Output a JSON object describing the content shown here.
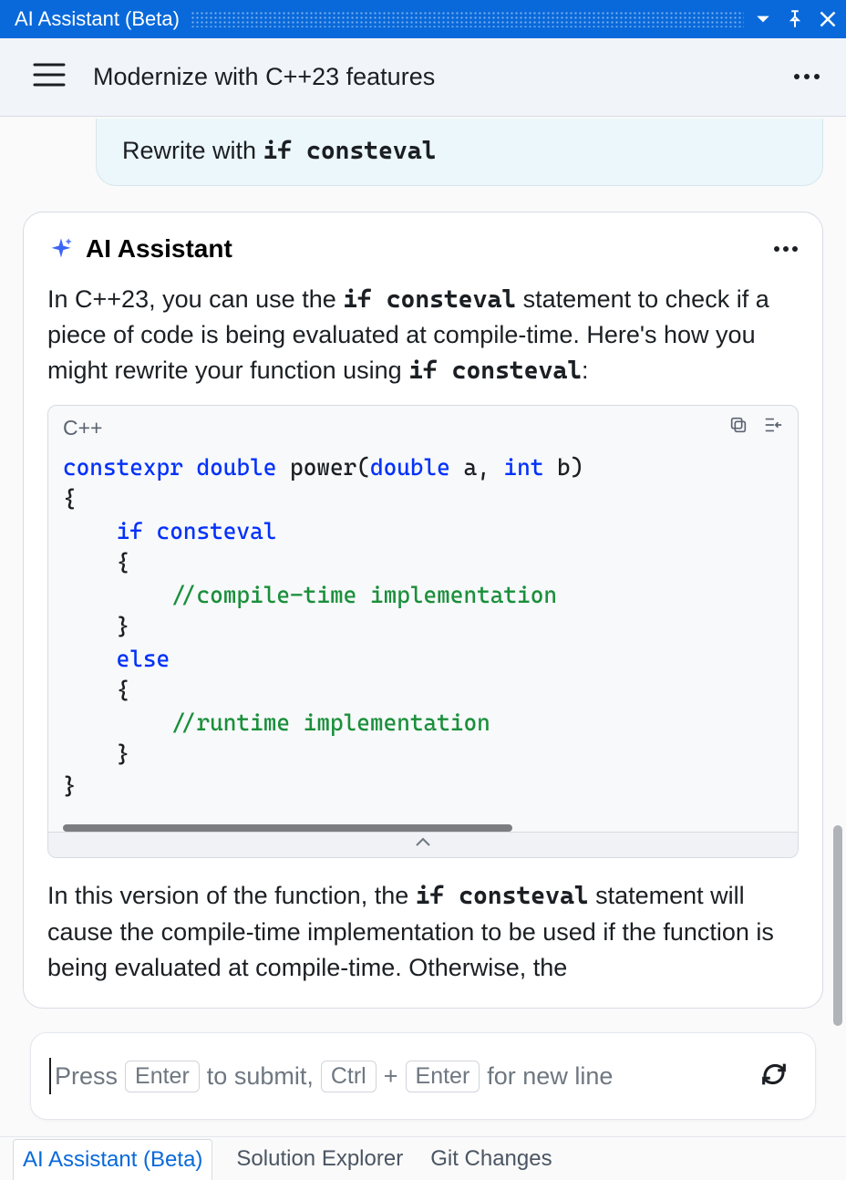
{
  "titlebar": {
    "title": "AI Assistant (Beta)"
  },
  "toolbar": {
    "title": "Modernize with C++23 features"
  },
  "user_message": {
    "prefix": "Rewrite with ",
    "code": "if consteval"
  },
  "assistant": {
    "name": "AI Assistant",
    "para1_a": "In C++23, you can use the ",
    "para1_code1": "if consteval",
    "para1_b": " statement to check if a piece of code is being evaluated at compile-time. Here's how you might rewrite your function using ",
    "para1_code2": "if consteval",
    "para1_c": ":",
    "code": {
      "lang": "C++",
      "lines": [
        {
          "t": "constexpr",
          "c": "kw"
        },
        {
          "t": " "
        },
        {
          "t": "double",
          "c": "ty"
        },
        {
          "t": " power("
        },
        {
          "t": "double",
          "c": "ty"
        },
        {
          "t": " a, "
        },
        {
          "t": "int",
          "c": "ty"
        },
        {
          "t": " b)"
        },
        {
          "nl": 1
        },
        {
          "t": "{"
        },
        {
          "nl": 1
        },
        {
          "t": "    "
        },
        {
          "t": "if consteval",
          "c": "kw"
        },
        {
          "nl": 1
        },
        {
          "t": "    {"
        },
        {
          "nl": 1
        },
        {
          "t": "        "
        },
        {
          "t": "//compile-time implementation",
          "c": "cm"
        },
        {
          "nl": 1
        },
        {
          "t": "    }"
        },
        {
          "nl": 1
        },
        {
          "t": "    "
        },
        {
          "t": "else",
          "c": "kw"
        },
        {
          "nl": 1
        },
        {
          "t": "    {"
        },
        {
          "nl": 1
        },
        {
          "t": "        "
        },
        {
          "t": "//runtime implementation",
          "c": "cm"
        },
        {
          "nl": 1
        },
        {
          "t": "    }"
        },
        {
          "nl": 1
        },
        {
          "t": "}"
        }
      ]
    },
    "para2_a": "In this version of the function, the ",
    "para2_code": "if consteval",
    "para2_b": " statement will cause the compile-time implementation to be used if the function is being evaluated at compile-time. Otherwise, the"
  },
  "input": {
    "hint_press": "Press",
    "hint_enter": "Enter",
    "hint_submit": "to submit,",
    "hint_ctrl": "Ctrl",
    "hint_plus": "+",
    "hint_enter2": "Enter",
    "hint_newline": "for new line"
  },
  "tabs": [
    {
      "label": "AI Assistant (Beta)",
      "active": true
    },
    {
      "label": "Solution Explorer",
      "active": false
    },
    {
      "label": "Git Changes",
      "active": false
    }
  ]
}
